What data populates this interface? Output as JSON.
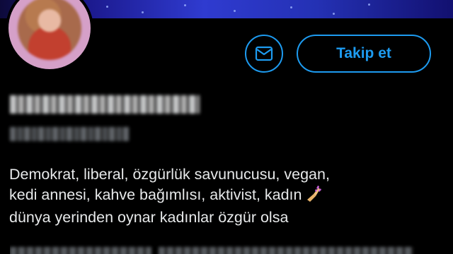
{
  "profile": {
    "follow_label": "Takip et",
    "bio_lines": [
      "Demokrat, liberal, özgürlük savunucusu, vegan,",
      "kedi annesi, kahve bağımlısı, aktivist, kadın",
      "dünya yerinden oynar kadınlar özgür olsa"
    ],
    "bio_emoji": "nail-polish-icon"
  },
  "colors": {
    "accent": "#1d9bf0",
    "background": "#000000",
    "text": "#e7e9ea",
    "avatar_ring": "#d5a0c8"
  }
}
